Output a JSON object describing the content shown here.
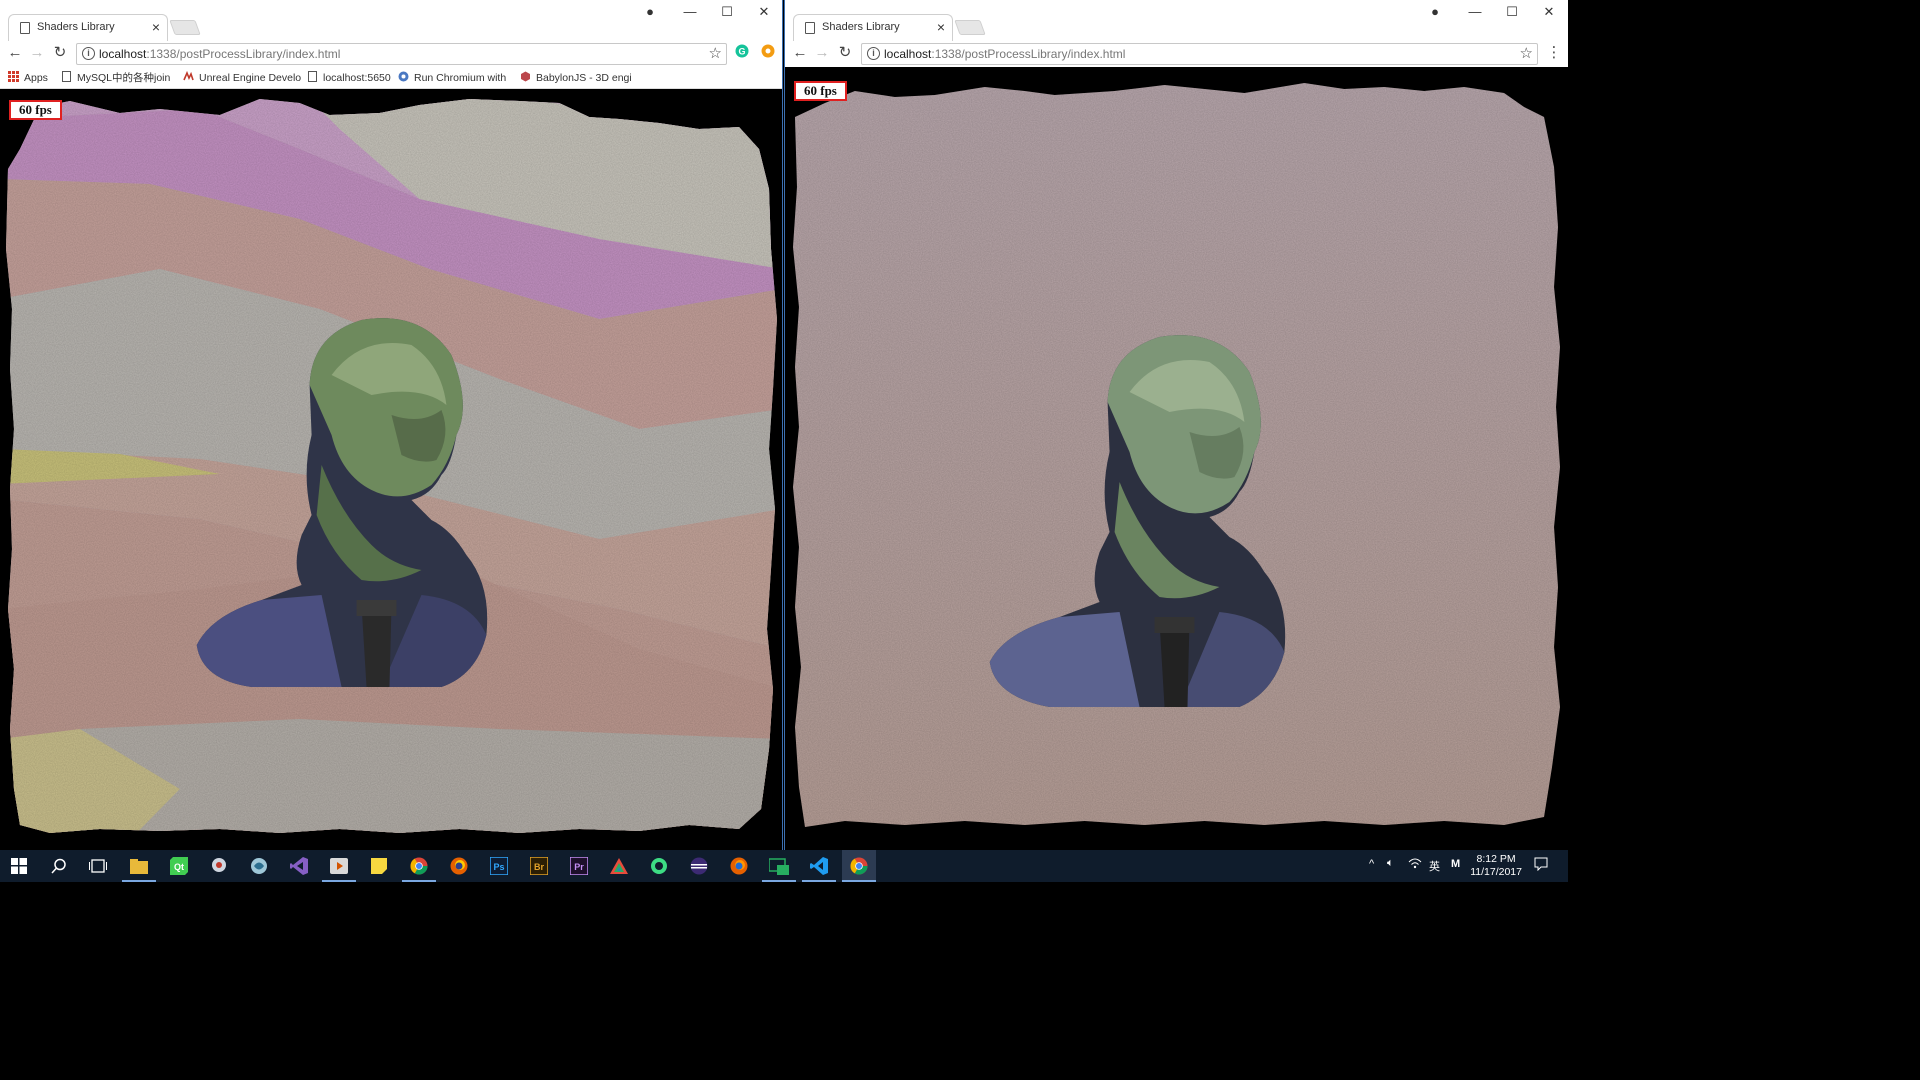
{
  "left_window": {
    "tab_title": "Shaders Library",
    "url_host": "localhost",
    "url_rest": ":1338/postProcessLibrary/index.html",
    "fps": "60 fps",
    "bookmarks": [
      {
        "label": "Apps",
        "icon": "apps-grid-icon"
      },
      {
        "label": "MySQL中的各种join",
        "icon": "page-icon"
      },
      {
        "label": "Unreal Engine Develo",
        "icon": "unreal-icon"
      },
      {
        "label": "localhost:5650",
        "icon": "page-icon"
      },
      {
        "label": "Run Chromium with",
        "icon": "chromium-icon"
      },
      {
        "label": "BabylonJS - 3D engi",
        "icon": "babylon-icon"
      }
    ],
    "effect": "watercolor with colored paper bands"
  },
  "right_window": {
    "tab_title": "Shaders Library",
    "url_host": "localhost",
    "url_rest": ":1338/postProcessLibrary/index.html",
    "fps": "60 fps",
    "effect": "watercolor paper"
  },
  "window_controls": {
    "minimize": "—",
    "maximize": "☐",
    "close": "✕",
    "profile": "profile-icon"
  },
  "taskbar": {
    "icons": [
      "windows-start-icon",
      "search-icon",
      "task-view-icon",
      "file-explorer-icon",
      "qt-creator-icon",
      "app-icon",
      "app-icon",
      "visual-studio-icon",
      "media-player-icon",
      "sticky-notes-icon",
      "chrome-icon",
      "firefox-icon",
      "photoshop-icon",
      "bridge-icon",
      "premiere-icon",
      "app-icon",
      "android-studio-icon",
      "eclipse-icon",
      "firefox-icon",
      "app-icon",
      "vscode-icon",
      "chrome-icon"
    ],
    "labels": {
      "ps": "Ps",
      "br": "Br",
      "pr": "Pr"
    },
    "tray": {
      "ime": "英",
      "mode": "M"
    },
    "time": "8:12 PM",
    "date": "11/17/2017"
  },
  "colors": {
    "accent_border": "#3b6fb0",
    "taskbar_bg": "#0f1c2c",
    "fps_border": "#e02020"
  }
}
